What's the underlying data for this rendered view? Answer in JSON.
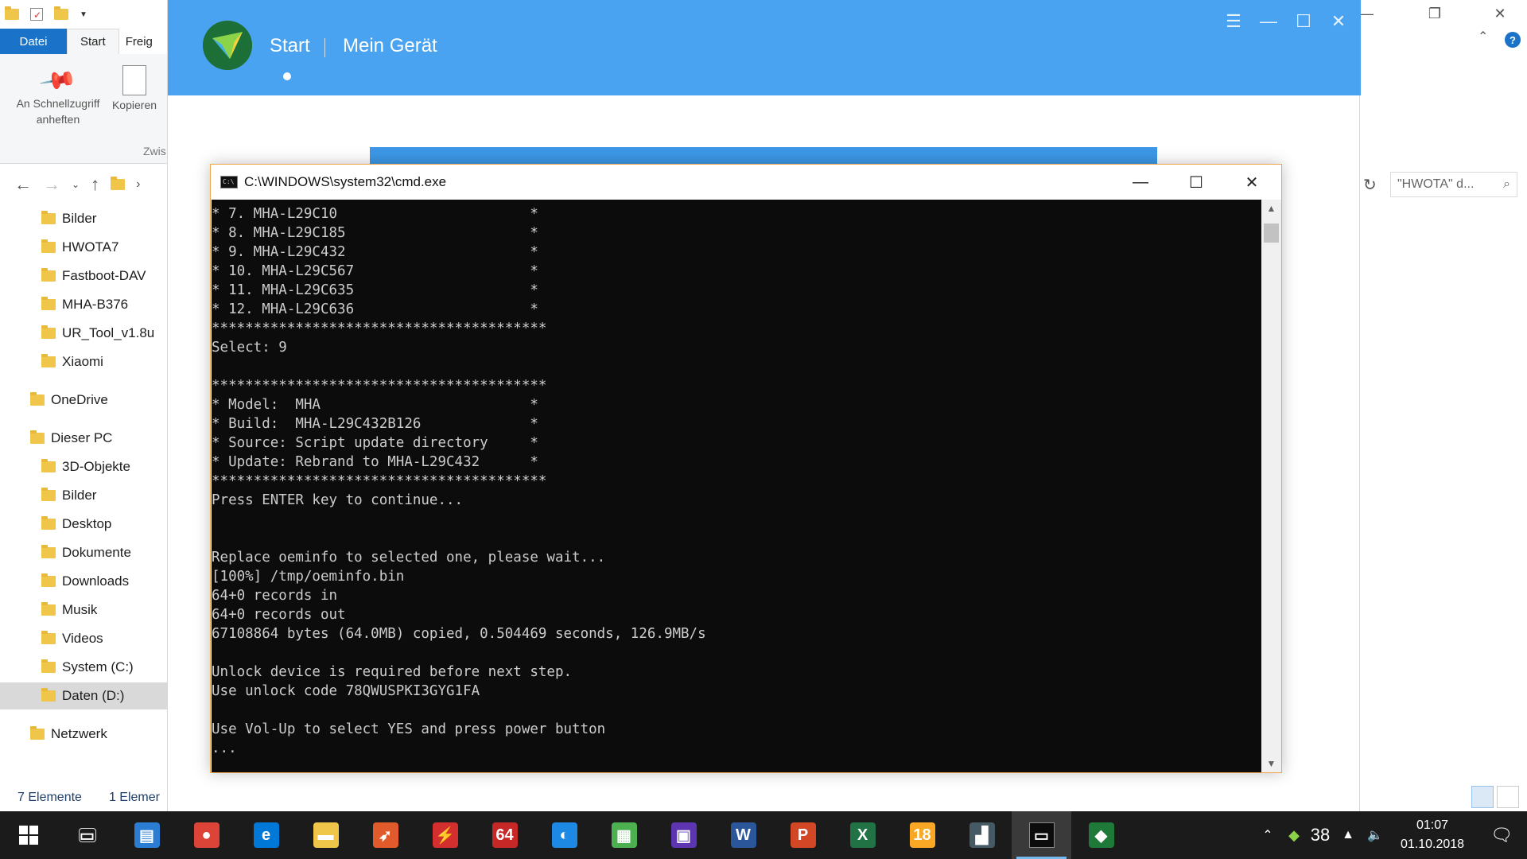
{
  "explorer": {
    "ribbon": {
      "tabs": [
        "Datei",
        "Start",
        "Freig"
      ],
      "pin_label_1": "An Schnellzugriff",
      "pin_label_2": "anheften",
      "copy_label": "Kopieren",
      "group_label": "Zwis"
    },
    "tree": [
      {
        "label": "Bilder",
        "indent": 2
      },
      {
        "label": "HWOTA7",
        "indent": 2
      },
      {
        "label": "Fastboot-DAV",
        "indent": 2
      },
      {
        "label": "MHA-B376",
        "indent": 2
      },
      {
        "label": "UR_Tool_v1.8u",
        "indent": 2
      },
      {
        "label": "Xiaomi",
        "indent": 2
      },
      {
        "label": "OneDrive",
        "indent": 1
      },
      {
        "label": "Dieser PC",
        "indent": 1
      },
      {
        "label": "3D-Objekte",
        "indent": 2
      },
      {
        "label": "Bilder",
        "indent": 2
      },
      {
        "label": "Desktop",
        "indent": 2
      },
      {
        "label": "Dokumente",
        "indent": 2
      },
      {
        "label": "Downloads",
        "indent": 2
      },
      {
        "label": "Musik",
        "indent": 2
      },
      {
        "label": "Videos",
        "indent": 2
      },
      {
        "label": "System (C:)",
        "indent": 2
      },
      {
        "label": "Daten (D:)",
        "indent": 2
      },
      {
        "label": "Netzwerk",
        "indent": 1
      }
    ],
    "status_count": "7 Elemente",
    "status_selected": "1 Elemer",
    "search_placeholder": "\"HWOTA\" d..."
  },
  "app": {
    "nav_start": "Start",
    "nav_device": "Mein Gerät",
    "accent": "#4aa3f0"
  },
  "cmd": {
    "title": "C:\\WINDOWS\\system32\\cmd.exe",
    "lines": [
      "* 7. MHA-L29C10                       *",
      "* 8. MHA-L29C185                      *",
      "* 9. MHA-L29C432                      *",
      "* 10. MHA-L29C567                     *",
      "* 11. MHA-L29C635                     *",
      "* 12. MHA-L29C636                     *",
      "****************************************",
      "Select: 9",
      "",
      "****************************************",
      "* Model:  MHA                         *",
      "* Build:  MHA-L29C432B126             *",
      "* Source: Script update directory     *",
      "* Update: Rebrand to MHA-L29C432      *",
      "****************************************",
      "Press ENTER key to continue...",
      "",
      "",
      "Replace oeminfo to selected one, please wait...",
      "[100%] /tmp/oeminfo.bin",
      "64+0 records in",
      "64+0 records out",
      "67108864 bytes (64.0MB) copied, 0.504469 seconds, 126.9MB/s",
      "",
      "Unlock device is required before next step.",
      "Use unlock code 78QWUSPKI3GYG1FA",
      "",
      "Use Vol-Up to select YES and press power button",
      "..."
    ]
  },
  "taskbar": {
    "apps": [
      {
        "name": "task-view",
        "color": "#1b1b1b",
        "glyph": "▭"
      },
      {
        "name": "outlook",
        "color": "#2b7cd3",
        "glyph": "▤"
      },
      {
        "name": "chrome",
        "color": "#db4437",
        "glyph": "●"
      },
      {
        "name": "edge",
        "color": "#0078d7",
        "glyph": "e"
      },
      {
        "name": "file-explorer",
        "color": "#f0c64a",
        "glyph": "▬"
      },
      {
        "name": "rocket-app",
        "color": "#e05a2b",
        "glyph": "➶"
      },
      {
        "name": "flash-app",
        "color": "#d32f2f",
        "glyph": "⚡"
      },
      {
        "name": "aida64",
        "color": "#c62828",
        "glyph": "64"
      },
      {
        "name": "browser-app",
        "color": "#1e88e5",
        "glyph": "◐"
      },
      {
        "name": "gpu-app",
        "color": "#4caf50",
        "glyph": "▦"
      },
      {
        "name": "cpu-app",
        "color": "#5e35b1",
        "glyph": "▣"
      },
      {
        "name": "word",
        "color": "#2b579a",
        "glyph": "W"
      },
      {
        "name": "powerpoint",
        "color": "#d24726",
        "glyph": "P"
      },
      {
        "name": "excel",
        "color": "#217346",
        "glyph": "X"
      },
      {
        "name": "app-18",
        "color": "#f9a825",
        "glyph": "18"
      },
      {
        "name": "benchmark-app",
        "color": "#455a64",
        "glyph": "▟"
      },
      {
        "name": "command-prompt",
        "color": "#0c0c0c",
        "glyph": "▭"
      },
      {
        "name": "hisuite",
        "color": "#1f7a3a",
        "glyph": "◆"
      }
    ],
    "tray_number": "38",
    "time": "01:07",
    "date": "01.10.2018"
  }
}
